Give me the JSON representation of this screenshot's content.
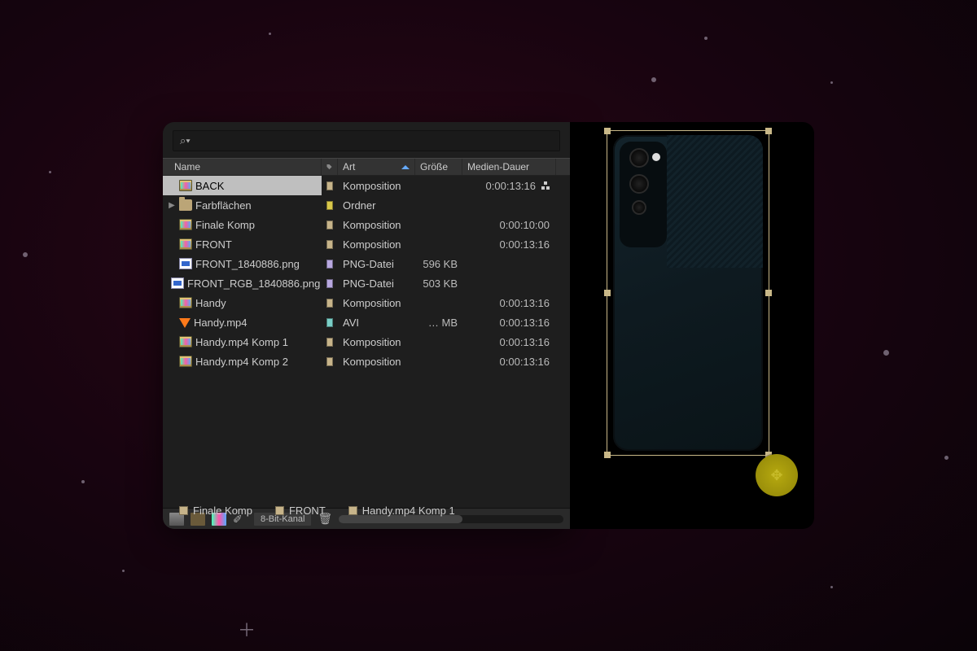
{
  "search": {
    "placeholder": ""
  },
  "columns": {
    "name": "Name",
    "tag": "",
    "art": "Art",
    "size": "Größe",
    "duration": "Medien-Dauer"
  },
  "items": [
    {
      "name": "BACK",
      "icon": "comp",
      "swatch": "tan",
      "art": "Komposition",
      "size": "",
      "dur": "0:00:13:16",
      "net": true,
      "selected": true
    },
    {
      "name": "Farbflächen",
      "icon": "folder",
      "swatch": "yellow",
      "art": "Ordner",
      "size": "",
      "dur": "",
      "expandable": true
    },
    {
      "name": "Finale Komp",
      "icon": "comp",
      "swatch": "tan",
      "art": "Komposition",
      "size": "",
      "dur": "0:00:10:00"
    },
    {
      "name": "FRONT",
      "icon": "comp",
      "swatch": "tan",
      "art": "Komposition",
      "size": "",
      "dur": "0:00:13:16"
    },
    {
      "name": "FRONT_1840886.png",
      "icon": "png",
      "swatch": "lav",
      "art": "PNG-Datei",
      "size": "596 KB",
      "dur": ""
    },
    {
      "name": "FRONT_RGB_1840886.png",
      "icon": "png",
      "swatch": "lav",
      "art": "PNG-Datei",
      "size": "503 KB",
      "dur": ""
    },
    {
      "name": "Handy",
      "icon": "comp",
      "swatch": "tan",
      "art": "Komposition",
      "size": "",
      "dur": "0:00:13:16"
    },
    {
      "name": "Handy.mp4",
      "icon": "avi",
      "swatch": "teal",
      "art": "AVI",
      "size": "… MB",
      "dur": "0:00:13:16"
    },
    {
      "name": "Handy.mp4 Komp 1",
      "icon": "comp",
      "swatch": "tan",
      "art": "Komposition",
      "size": "",
      "dur": "0:00:13:16"
    },
    {
      "name": "Handy.mp4 Komp 2",
      "icon": "comp",
      "swatch": "tan",
      "art": "Komposition",
      "size": "",
      "dur": "0:00:13:16"
    }
  ],
  "toolbar": {
    "bit_depth": "8-Bit-Kanal"
  },
  "flow_tabs": [
    {
      "label": "Finale Komp"
    },
    {
      "label": "FRONT"
    },
    {
      "label": "Handy.mp4 Komp 1"
    }
  ]
}
